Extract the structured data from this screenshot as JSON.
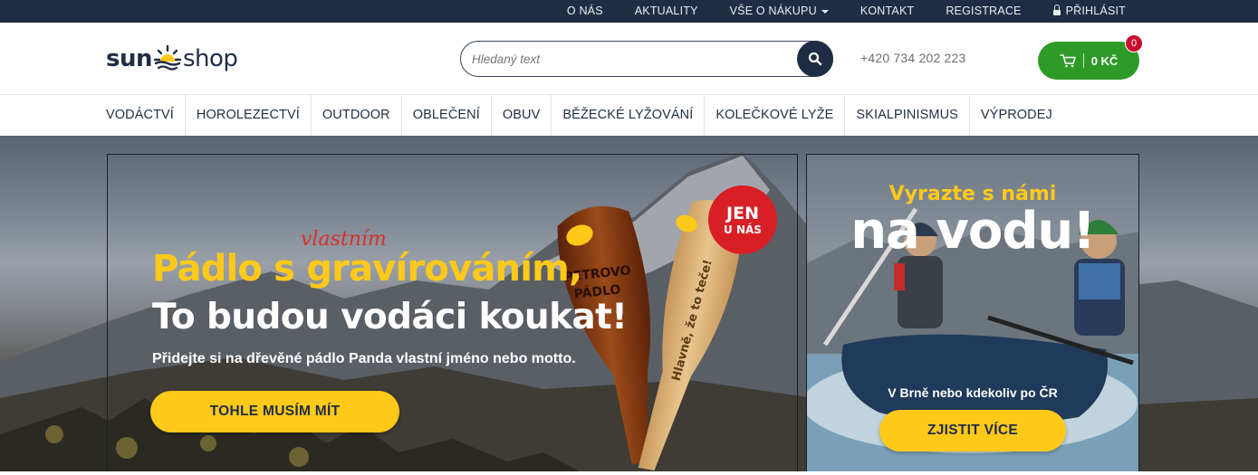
{
  "topbar": {
    "links": [
      "O NÁS",
      "AKTUALITY",
      "VŠE O NÁKUPU",
      "KONTAKT",
      "REGISTRACE",
      "PŘIHLÁSIT"
    ]
  },
  "header": {
    "logo_left": "sun",
    "logo_right": "shop",
    "search_placeholder": "Hledaný text",
    "phone": "+420 734 202 223",
    "cart_total": "0 KČ",
    "cart_count": "0"
  },
  "nav": {
    "items": [
      "VODÁCTVÍ",
      "HOROLEZECTVÍ",
      "OUTDOOR",
      "OBLEČENÍ",
      "OBUV",
      "BĚŽECKÉ LYŽOVÁNÍ",
      "KOLEČKOVÉ LYŽE",
      "SKIALPINISMUS",
      "VÝPRODEJ"
    ]
  },
  "hero": {
    "headline_yellow": "Pádlo s gravírováním,",
    "headline_script": "vlastním",
    "headline_white": "To budou vodáci koukat!",
    "subline": "Přidejte si na dřevěné pádlo Panda vlastní jméno nebo motto.",
    "cta": "TOHLE MUSÍM MÍT",
    "badge_line1": "JEN",
    "badge_line2": "U NÁS",
    "paddle1_text": "PETROVO PÁDLO",
    "paddle2_text": "Hlavně, že to teče!"
  },
  "side": {
    "title_yellow": "Vyrazte s námi",
    "title_white": "na vodu!",
    "subline": "V Brně nebo kdekoliv po ČR",
    "cta": "ZJISTIT VÍCE"
  },
  "colors": {
    "navy": "#1f2d44",
    "yellow": "#ffc91a",
    "green": "#2e9b28",
    "red": "#d81f26"
  }
}
